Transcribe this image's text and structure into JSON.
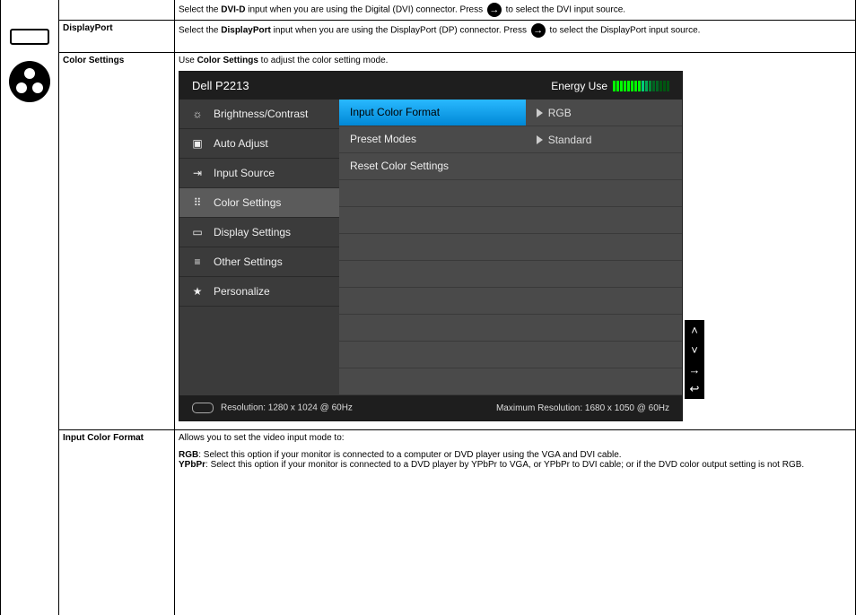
{
  "rows": {
    "dvid_desc_pre": "Select the ",
    "dvid_bold": "DVI-D",
    "dvid_desc_mid": " input when you are using the Digital (DVI) connector. Press ",
    "dvid_desc_post": " to select the DVI input source.",
    "displayport_label": "DisplayPort",
    "dp_desc_pre": "Select the ",
    "dp_bold": "DisplayPort",
    "dp_desc_mid": " input when you are using the DisplayPort (DP) connector. Press ",
    "dp_desc_post": " to select the DisplayPort input source.",
    "color_settings_label": "Color Settings",
    "cs_desc_pre": "Use ",
    "cs_bold": "Color Settings",
    "cs_desc_post": " to adjust the color setting mode.",
    "input_color_format_label": "Input Color Format",
    "icf_line1": "Allows you to set the video input mode to:",
    "icf_rgb_bold": "RGB",
    "icf_rgb_text": ": Select this option if your monitor is connected to a computer or DVD player using the VGA and DVI cable.",
    "icf_yp_bold": "YPbPr",
    "icf_yp_text": ": Select this option if your monitor is connected to a DVD player by YPbPr to VGA, or YPbPr to DVI cable; or if the DVD color output setting is not RGB."
  },
  "osd": {
    "title": "Dell P2213",
    "energy_label": "Energy Use",
    "left_items": [
      "Brightness/Contrast",
      "Auto Adjust",
      "Input Source",
      "Color Settings",
      "Display Settings",
      "Other Settings",
      "Personalize"
    ],
    "right": {
      "input_color_format": "Input Color Format",
      "rgb": "RGB",
      "preset_modes": "Preset Modes",
      "standard": "Standard",
      "reset": "Reset Color Settings"
    },
    "footer": {
      "resolution": "Resolution: 1280 x 1024 @ 60Hz",
      "max_resolution": "Maximum Resolution: 1680 x 1050 @ 60Hz"
    }
  },
  "arrow_glyph": "→",
  "side_glyphs": {
    "up": "˄",
    "down": "˅",
    "right": "→",
    "back": "↩"
  }
}
